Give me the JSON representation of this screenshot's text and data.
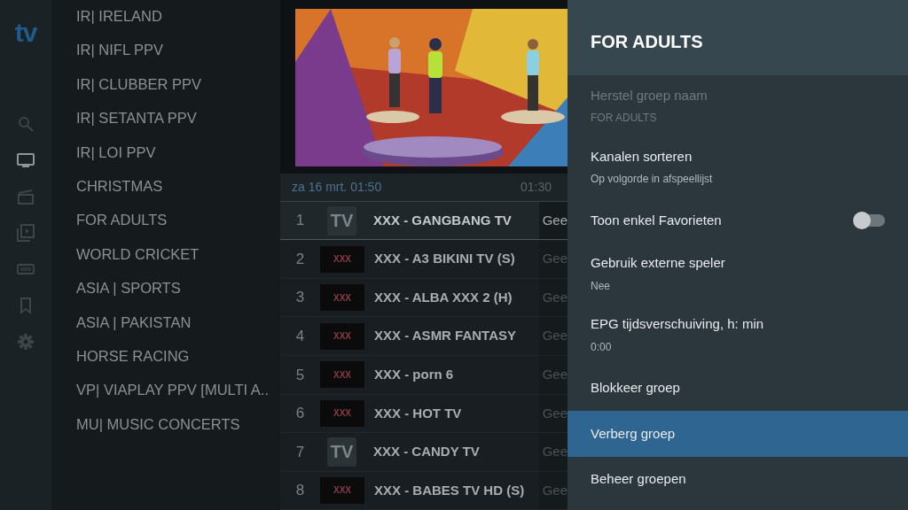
{
  "logo": "tv",
  "nav": [
    {
      "kind": "search",
      "selected": false
    },
    {
      "kind": "tv",
      "selected": true
    },
    {
      "kind": "movies",
      "selected": false
    },
    {
      "kind": "series",
      "selected": false
    },
    {
      "kind": "dvr",
      "selected": false
    },
    {
      "kind": "bookmark",
      "selected": false
    },
    {
      "kind": "settings",
      "selected": false
    }
  ],
  "groups": [
    "IR| IRELAND",
    "IR| NIFL PPV",
    "IR| CLUBBER PPV",
    "IR| SETANTA PPV",
    "IR| LOI PPV",
    "CHRISTMAS",
    "FOR ADULTS",
    "WORLD CRICKET",
    "ASIA | SPORTS",
    "ASIA | PAKISTAN",
    "HORSE RACING",
    "VP| VIAPLAY PPV [MULTI A..",
    "MU| MUSIC CONCERTS"
  ],
  "epg_bar": {
    "date": "za 16 mrt. 01:50",
    "time": "01:30"
  },
  "channels": [
    {
      "number": "1",
      "kind": "generic-logo",
      "logo_text": "TV",
      "name": "XXX - GANGBANG TV",
      "program": "Gee",
      "selected": true
    },
    {
      "number": "2",
      "kind": "adult-logo",
      "logo_text": "XXX",
      "name": "XXX - A3 BIKINI TV (S)",
      "program": "Gee",
      "selected": false
    },
    {
      "number": "3",
      "kind": "adult-logo",
      "logo_text": "XXX",
      "name": "XXX - ALBA XXX 2 (H)",
      "program": "Gee",
      "selected": false
    },
    {
      "number": "4",
      "kind": "adult-logo",
      "logo_text": "XXX",
      "name": "XXX - ASMR FANTASY",
      "program": "Gee",
      "selected": false
    },
    {
      "number": "5",
      "kind": "adult-logo",
      "logo_text": "XXX",
      "name": "XXX - porn 6",
      "program": "Gee",
      "selected": false
    },
    {
      "number": "6",
      "kind": "adult-logo",
      "logo_text": "XXX",
      "name": "XXX - HOT TV",
      "program": "Gee",
      "selected": false
    },
    {
      "number": "7",
      "kind": "generic-logo",
      "logo_text": "TV",
      "name": "XXX - CANDY TV",
      "program": "Gee",
      "selected": false
    },
    {
      "number": "8",
      "kind": "adult-logo",
      "logo_text": "XXX",
      "name": "XXX - BABES TV HD (S)",
      "program": "Gee",
      "selected": false
    }
  ],
  "panel": {
    "title": "FOR ADULTS",
    "items": [
      {
        "kind": "text",
        "label": "Herstel groep naam",
        "value": "FOR ADULTS",
        "disabled": true,
        "selected": false
      },
      {
        "kind": "text",
        "label": "Kanalen sorteren",
        "value": "Op volgorde in afspeellijst",
        "disabled": false,
        "selected": false
      },
      {
        "kind": "switch",
        "label": "Toon enkel Favorieten",
        "on": false,
        "disabled": false,
        "selected": false
      },
      {
        "kind": "text",
        "label": "Gebruik externe speler",
        "value": "Nee",
        "disabled": false,
        "selected": false
      },
      {
        "kind": "text",
        "label": "EPG tijdsverschuiving, h: min",
        "value": "0:00",
        "disabled": false,
        "selected": false
      },
      {
        "kind": "text",
        "label": "Blokkeer groep",
        "disabled": false,
        "selected": false
      },
      {
        "kind": "text",
        "label": "Verberg groep",
        "disabled": false,
        "selected": true
      },
      {
        "kind": "text",
        "label": "Beheer groepen",
        "disabled": false,
        "selected": false
      }
    ]
  }
}
